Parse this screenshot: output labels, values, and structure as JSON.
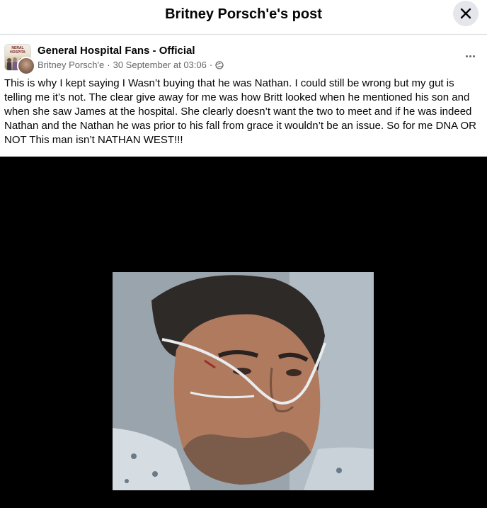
{
  "dialog": {
    "title": "Britney Porsch'e's post",
    "close_icon": "close-icon"
  },
  "post": {
    "group_name": "General Hospital Fans - Official",
    "group_avatar_banner": "NERAL HOSPITA",
    "author": "Britney Porsch'e",
    "separator": "·",
    "timestamp": "30 September at 03:06",
    "separator2": "·",
    "privacy_icon": "globe-icon",
    "more_icon": "more-options-icon",
    "text": "This is why I kept saying I Wasn’t buying that he was Nathan. I could still be wrong but my gut is telling me it’s not. The clear give away for me was how Britt looked when he mentioned his son and when she saw James at the hospital. She clearly doesn’t want the two to meet and if he was indeed Nathan and the Nathan he was prior to his fall from grace it wouldn’t be an issue. So for me DNA OR NOT This man isn’t NATHAN WEST!!!"
  },
  "colors": {
    "text_primary": "#050505",
    "text_secondary": "#65676b",
    "close_bg": "#e4e6eb",
    "media_bg": "#000000"
  }
}
